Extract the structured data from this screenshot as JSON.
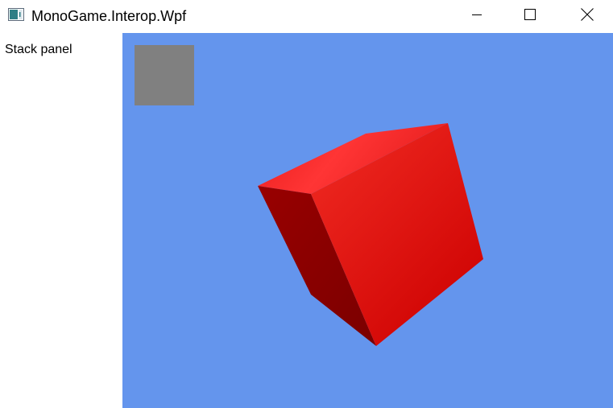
{
  "window": {
    "title": "MonoGame.Interop.Wpf",
    "icon": "app-window-icon",
    "controls": {
      "minimize_icon": "minimize-icon",
      "maximize_icon": "maximize-icon",
      "close_icon": "close-icon"
    }
  },
  "left_panel": {
    "label": "Stack panel"
  },
  "viewport": {
    "background_color": "#6495ED",
    "overlay_square_color": "#808080",
    "cube": {
      "top_face_color": "#ff3030",
      "front_face_color": "#e8201a",
      "side_face_color": "#8b0000"
    }
  }
}
